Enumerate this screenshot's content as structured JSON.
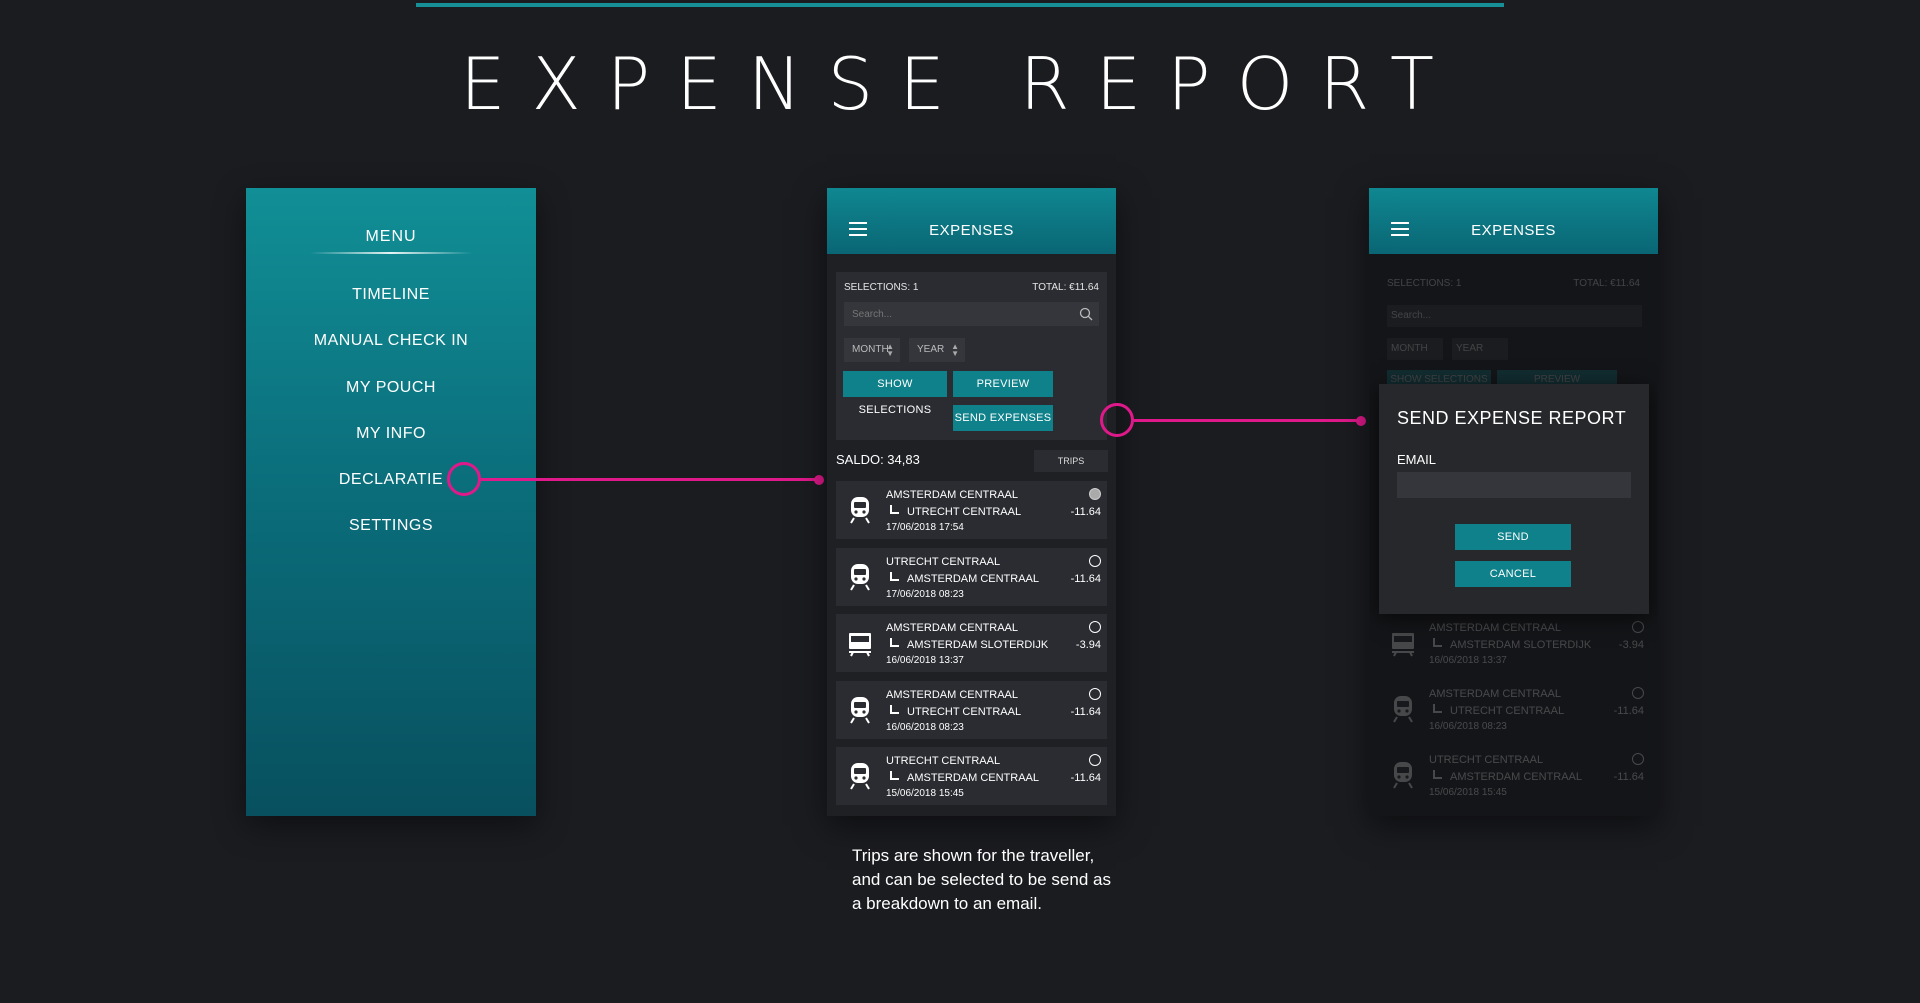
{
  "page_title": "EXPENSE REPORT",
  "caption": "Trips are shown for the traveller, and can be selected to be send as a breakdown to an email.",
  "colors": {
    "accent": "#0f818a",
    "callout": "#e0198b",
    "background": "#1b1c20"
  },
  "menu": {
    "title": "MENU",
    "items": [
      {
        "label": "TIMELINE"
      },
      {
        "label": "MANUAL CHECK IN"
      },
      {
        "label": "MY POUCH"
      },
      {
        "label": "MY INFO"
      },
      {
        "label": "DECLARATIE"
      },
      {
        "label": "SETTINGS"
      }
    ]
  },
  "expenses": {
    "title": "EXPENSES",
    "selections": "SELECTIONS: 1",
    "total": "TOTAL: €11.64",
    "search_placeholder": "Search...",
    "month": "MONTH",
    "year": "YEAR",
    "show_selections": "SHOW SELECTIONS",
    "preview": "PREVIEW",
    "send_expenses": "SEND EXPENSES",
    "saldo": "SALDO: 34,83",
    "trips_filter": "TRIPS",
    "trips": [
      {
        "from": "AMSTERDAM CENTRAAL",
        "to": "UTRECHT CENTRAAL",
        "date": "17/06/2018  17:54",
        "amount": "-11.64",
        "icon": "train-icon",
        "selected": true
      },
      {
        "from": "UTRECHT CENTRAAL",
        "to": "AMSTERDAM CENTRAAL",
        "date": "17/06/2018  08:23",
        "amount": "-11.64",
        "icon": "train-icon",
        "selected": false
      },
      {
        "from": "AMSTERDAM CENTRAAL",
        "to": "AMSTERDAM SLOTERDIJK",
        "date": "16/06/2018  13:37",
        "amount": "-3.94",
        "icon": "sprinter-icon",
        "selected": false
      },
      {
        "from": "AMSTERDAM CENTRAAL",
        "to": "UTRECHT CENTRAAL",
        "date": "16/06/2018  08:23",
        "amount": "-11.64",
        "icon": "train-icon",
        "selected": false
      },
      {
        "from": "UTRECHT CENTRAAL",
        "to": "AMSTERDAM CENTRAAL",
        "date": "15/06/2018  15:45",
        "amount": "-11.64",
        "icon": "train-icon",
        "selected": false
      }
    ]
  },
  "send_report": {
    "header_title": "EXPENSES",
    "selections": "SELECTIONS: 1",
    "total": "TOTAL: €11.64",
    "search_placeholder": "Search...",
    "month": "MONTH",
    "year": "YEAR",
    "show_selections": "SHOW SELECTIONS",
    "preview": "PREVIEW",
    "modal_title": "SEND EXPENSE REPORT",
    "email_label": "EMAIL",
    "send": "SEND",
    "cancel": "CANCEL",
    "trips": [
      {
        "from": "AMSTERDAM CENTRAAL",
        "to": "AMSTERDAM SLOTERDIJK",
        "date": "16/06/2018  13:37",
        "amount": "-3.94",
        "icon": "sprinter-icon"
      },
      {
        "from": "AMSTERDAM CENTRAAL",
        "to": "UTRECHT CENTRAAL",
        "date": "16/06/2018  08:23",
        "amount": "-11.64",
        "icon": "train-icon"
      },
      {
        "from": "UTRECHT CENTRAAL",
        "to": "AMSTERDAM CENTRAAL",
        "date": "15/06/2018  15:45",
        "amount": "-11.64",
        "icon": "train-icon"
      }
    ]
  }
}
